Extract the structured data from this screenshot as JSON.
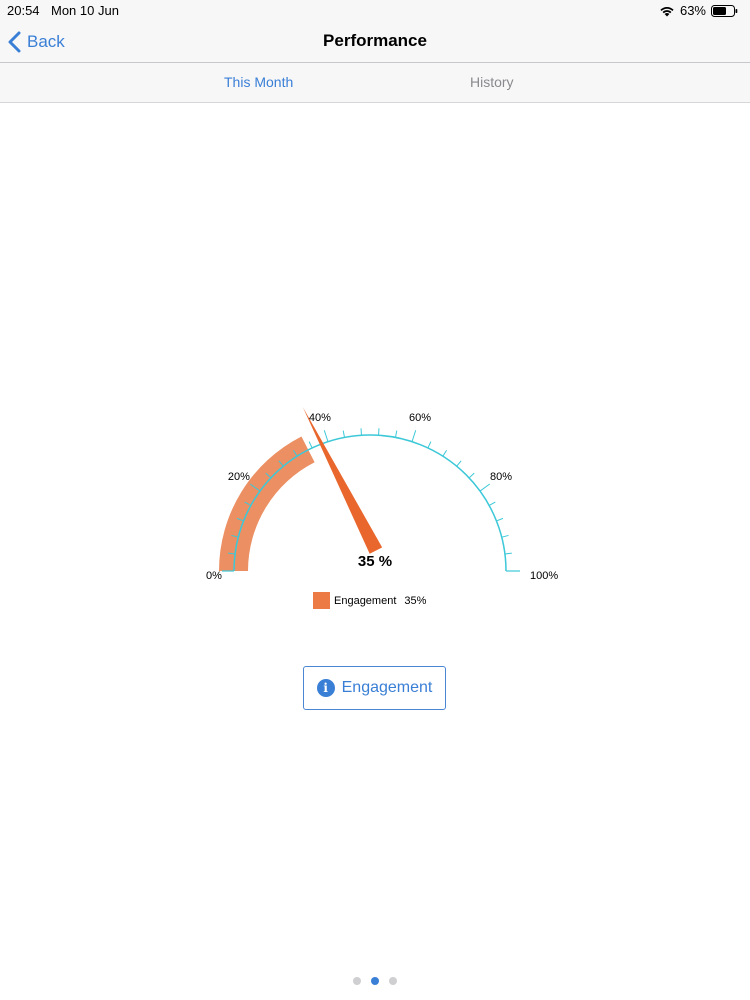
{
  "status_bar": {
    "time": "20:54",
    "date": "Mon 10 Jun",
    "battery_percent": "63%",
    "icons": [
      "wifi-icon",
      "battery-icon"
    ]
  },
  "nav": {
    "back_label": "Back",
    "title": "Performance",
    "accent_color": "#3a7fd6"
  },
  "tabs": [
    {
      "label": "This Month",
      "selected": true
    },
    {
      "label": "History",
      "selected": false
    }
  ],
  "chart_data": {
    "type": "gauge",
    "min": 0,
    "max": 100,
    "value": 35,
    "value_label": "35 %",
    "tick_labels": [
      "0%",
      "20%",
      "40%",
      "60%",
      "80%",
      "100%"
    ],
    "tick_values": [
      0,
      20,
      40,
      60,
      80,
      100
    ],
    "minor_tick_step": 4,
    "series": [
      {
        "name": "Engagement",
        "value": 35,
        "value_text": "35%",
        "color": "#ec7a45"
      }
    ],
    "scale_color": "#3cc8d8",
    "band_color": "#ec8f63",
    "needle_color": "#e9672d",
    "legend_position": "bottom"
  },
  "engagement_button": {
    "label": "Engagement",
    "icon": "info-icon",
    "icon_glyph": "i"
  },
  "pager": {
    "count": 3,
    "active_index": 1
  }
}
